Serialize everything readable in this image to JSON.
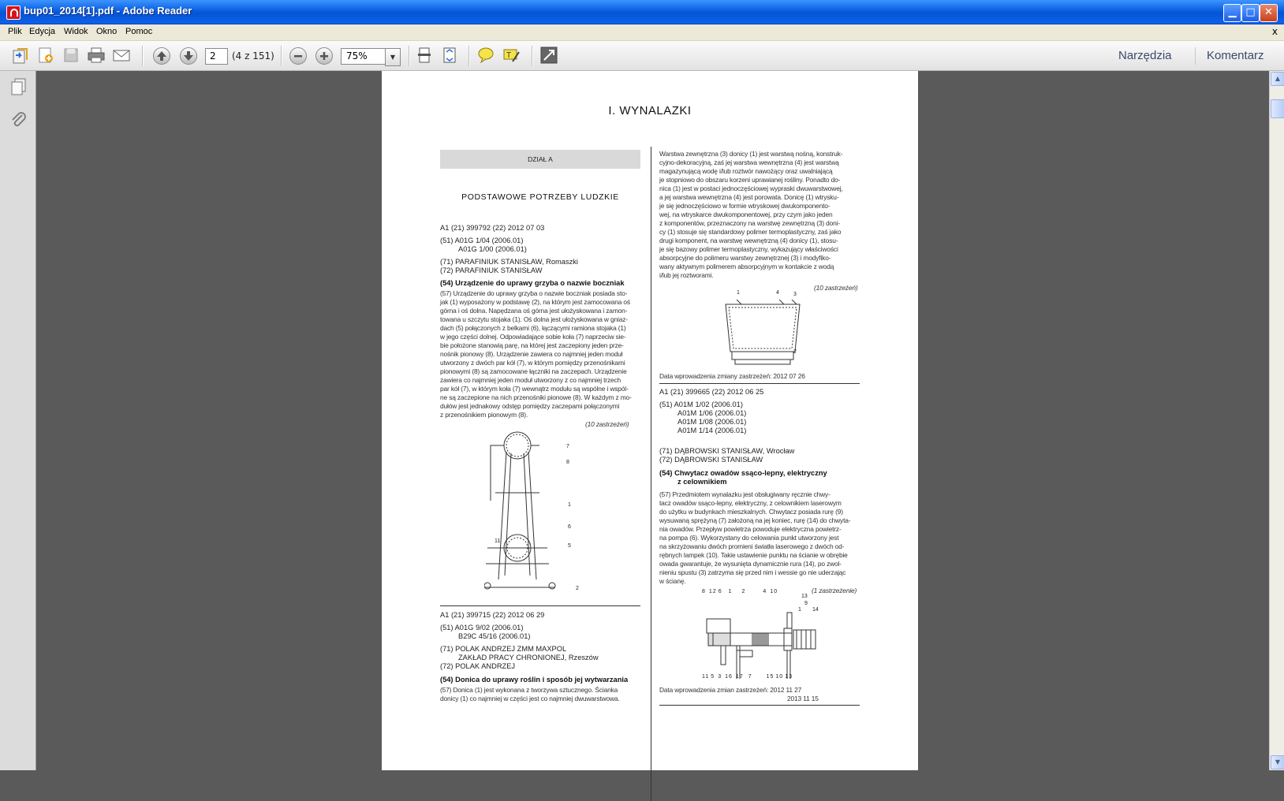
{
  "window": {
    "title": "bup01_2014[1].pdf - Adobe Reader",
    "min_glyph": "▁",
    "max_glyph": "□",
    "close_glyph": "✕"
  },
  "menu": [
    "Plik",
    "Edycja",
    "Widok",
    "Okno",
    "Pomoc"
  ],
  "menu_close": "x",
  "toolbar": {
    "page_number": "2",
    "page_count": "(4 z 151)",
    "zoom": "75%",
    "tools_label": "Narzędzia",
    "comment_label": "Komentarz"
  },
  "document": {
    "title": "I. WYNALAZKI",
    "section_bar": "DZIAŁ A",
    "section_heading": "PODSTAWOWE POTRZEBY LUDZKIE",
    "entry1": {
      "head": "A1 (21) 399792 (22) 2012 07 03",
      "ipc": [
        "(51) A01G 1/04 (2006.01)",
        "A01G 1/00 (2006.01)"
      ],
      "applicant": "(71) PARAFINIUK STANISŁAW, Romaszki",
      "inventor": "(72) PARAFINIUK STANISŁAW",
      "title": "(54) Urządzenie do uprawy grzyba o nazwie boczniak",
      "abstract": [
        "(57) Urządzenie do uprawy grzyba o nazwie boczniak posiada sto-",
        "jak (1) wyposażony w podstawę (2), na którym jest zamocowana oś",
        "górna i oś dolna. Napędzana oś górna jest ułożyskowana i zamon-",
        "towana u szczytu stojaka (1). Oś dolna jest ułożyskowana w gniaz-",
        "dach (5) połączonych z belkami (6), łączącymi ramiona stojaka (1)",
        "w jego części dolnej. Odpowiadające sobie koła (7) naprzeciw sie-",
        "bie położone stanowią parę, na której jest zaczepiony jeden prze-",
        "nośnik pionowy (8). Urządzenie zawiera co najmniej jeden moduł",
        "utworzony z dwóch par kół (7), w którym pomiędzy przenośnikami",
        "pionowymi (8) są zamocowane łączniki na zaczepach. Urządzenie",
        "zawiera co najmniej jeden moduł utworzony z co najmniej trzech",
        "par kół (7), w którym koła (7) wewnątrz modułu są wspólne i wspól-",
        "ne są zaczepione na nich przenośniki pionowe (8). W każdym z mo-",
        "dułów jest jednakowy odstęp pomiędzy zaczepami połączonymi",
        "z przenośnikiem pionowym (8)."
      ],
      "claims": "(10 zastrzeżeń)"
    },
    "entry2": {
      "head": "A1 (21) 399715 (22) 2012 06 29",
      "ipc": [
        "(51) A01G 9/02 (2006.01)",
        "B29C 45/16 (2006.01)"
      ],
      "applicant": [
        "(71) POLAK ANDRZEJ ZMM MAXPOL",
        "ZAKŁAD PRACY CHRONIONEJ, Rzeszów"
      ],
      "inventor": "(72) POLAK ANDRZEJ",
      "title": "(54) Donica do uprawy roślin i sposób jej wytwarzania",
      "abstract": [
        "(57) Donica (1) jest wykonana z tworzywa sztucznego. Ścianka",
        "donicy (1) co najmniej w części jest co najmniej dwuwarstwowa."
      ]
    },
    "right_text": [
      "Warstwa zewnętrzna (3) donicy (1) jest warstwą nośną, konstruk-",
      "cyjno-dekoracyjną, zaś jej warstwa wewnętrzna (4) jest warstwą",
      "magazynującą wodę i/lub roztwór nawożący oraz uwalniającą",
      "je stopniowo do obszaru korzeni uprawianej rośliny. Ponadto do-",
      "nica (1) jest w postaci jednoczęściowej wypraski dwuwarstwowej,",
      "a jej warstwa wewnętrzna (4) jest porowata. Donicę (1) wtrysku-",
      "je się jednoczęściowo w formie wtryskowej dwukomponento-",
      "wej, na wtryskarce dwukomponentowej, przy czym jako jeden",
      "z komponentów, przeznaczony na warstwę zewnętrzną (3) doni-",
      "cy (1) stosuje się standardowy polimer termoplastyczny, zaś jako",
      "drugi komponent, na warstwę wewnętrzną (4) donicy (1), stosu-",
      "je się bazowy polimer termoplastyczny, wykazujący właściwości",
      "absorpcyjne do polimeru warstwy zewnętrznej (3) i modyfiko-",
      "wany aktywnym polimerem absorpcyjnym w kontakcie z wodą",
      "i/lub jej roztworami."
    ],
    "right_claims": "(10 zastrzeżeń)",
    "change_date1": "Data wprowadzenia zmiany zastrzeżeń: 2012 07 26",
    "entry3": {
      "head": "A1 (21) 399665 (22) 2012 06 25",
      "ipc": [
        "(51) A01M 1/02 (2006.01)",
        "A01M 1/06 (2006.01)",
        "A01M 1/08 (2006.01)",
        "A01M 1/14 (2006.01)"
      ],
      "applicant": "(71) DĄBROWSKI STANISŁAW, Wrocław",
      "inventor": "(72) DĄBROWSKI STANISŁAW",
      "title": [
        "(54) Chwytacz owadów ssąco-lepny, elektryczny",
        "z celownikiem"
      ],
      "abstract": [
        "(57) Przedmiotem wynalazku jest obsługiwany ręcznie chwy-",
        "tacz owadów ssąco-lepny, elektryczny, z celownikiem laserowym",
        "do użytku w budynkach mieszkalnych. Chwytacz posiada rurę (9)",
        "wysuwaną sprężyną (7) założoną na jej koniec, rurę (14) do chwyta-",
        "nia owadów. Przepływ powietrza powoduje elektryczna powietrz-",
        "na pompa (6). Wykorzystany do celowania punkt utworzony jest",
        "na skrzyżowaniu dwóch promieni światła laserowego z dwóch od-",
        "rębnych lampek (10). Takie ustawienie punktu na ścianie w obrębie",
        "owada gwarantuje, że wysunięta dynamicznie rura (14), po zwol-",
        "nieniu spustu (3) zatrzyma się przed nim i wessie go nie uderzając",
        "w ścianę."
      ],
      "claims": "(1 zastrzeżenie)",
      "change_date": [
        "Data wprowadzenia zmian zastrzeżeń: 2012 11 27",
        "2013 11 15"
      ]
    },
    "fig1_labels": [
      "7",
      "8",
      "1",
      "6",
      "5",
      "11",
      "2"
    ],
    "fig2_labels": [
      "1",
      "4",
      "3",
      "2"
    ],
    "fig3_labels_top": [
      "8",
      "12",
      "6",
      "1",
      "2",
      "4",
      "10",
      "13",
      "9",
      "1",
      "14"
    ],
    "fig3_labels_bottom": [
      "11",
      "5",
      "3",
      "16",
      "17",
      "7",
      "15",
      "10",
      "13"
    ]
  }
}
